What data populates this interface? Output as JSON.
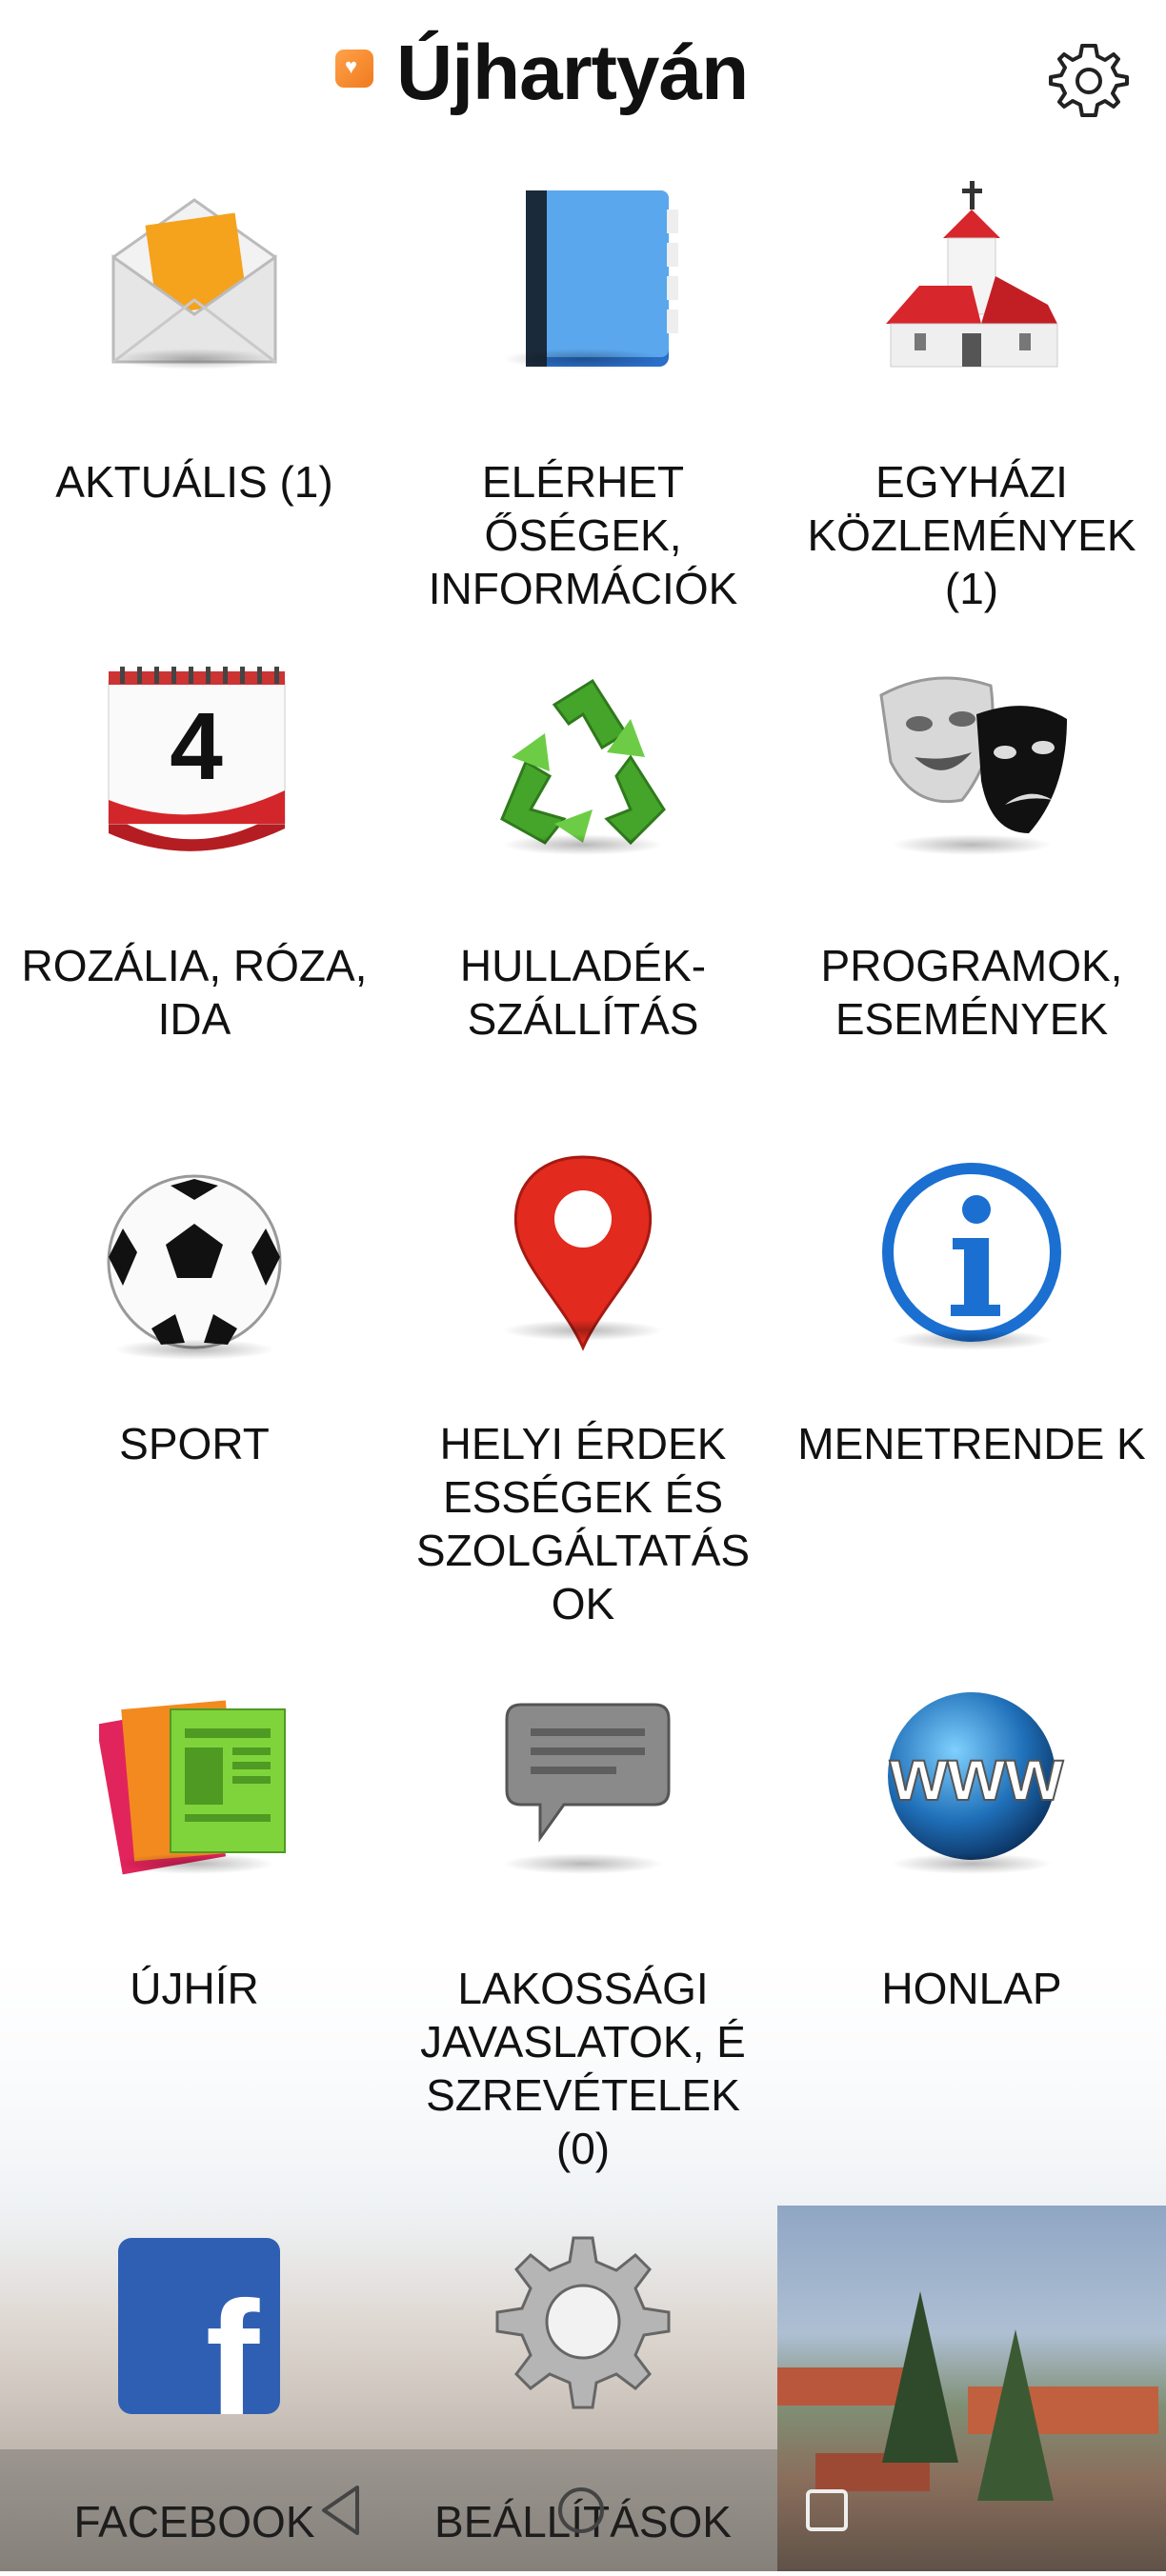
{
  "app": {
    "title": "Újhartyán"
  },
  "tiles": [
    {
      "label": "AKTUÁLIS (1)",
      "icon": "envelope-icon"
    },
    {
      "label": "ELÉRHET ŐSÉGEK, INFORMÁCIÓK",
      "icon": "address-book-icon"
    },
    {
      "label": "EGYHÁZI KÖZLEMÉNYEK (1)",
      "icon": "church-icon"
    },
    {
      "label": "ROZÁLIA, RÓZA, IDA",
      "icon": "calendar-icon",
      "calendar_day": "4"
    },
    {
      "label": "HULLADÉK- SZÁLLÍTÁS",
      "icon": "recycle-icon"
    },
    {
      "label": "PROGRAMOK, ESEMÉNYEK",
      "icon": "theater-masks-icon"
    },
    {
      "label": "SPORT",
      "icon": "soccer-ball-icon"
    },
    {
      "label": "HELYI ÉRDEK ESSÉGEK ÉS SZOLGÁLTATÁS OK",
      "icon": "map-pin-icon"
    },
    {
      "label": "MENETRENDE K",
      "icon": "info-icon"
    },
    {
      "label": "ÚJHÍR",
      "icon": "newspaper-icon"
    },
    {
      "label": "LAKOSSÁGI JAVASLATOK, É SZREVÉTELEK (0)",
      "icon": "speech-bubble-icon"
    },
    {
      "label": "HONLAP",
      "icon": "globe-www-icon",
      "icon_text": "www"
    },
    {
      "label": "FACEBOOK",
      "icon": "facebook-icon",
      "icon_text": "f"
    },
    {
      "label": "BEÁLLÍTÁSOK",
      "icon": "gear-icon"
    }
  ],
  "navbar": {
    "buttons": [
      "back-icon",
      "home-icon",
      "recents-icon"
    ]
  },
  "colors": {
    "accent": "#f07a1e",
    "text": "#111111"
  }
}
